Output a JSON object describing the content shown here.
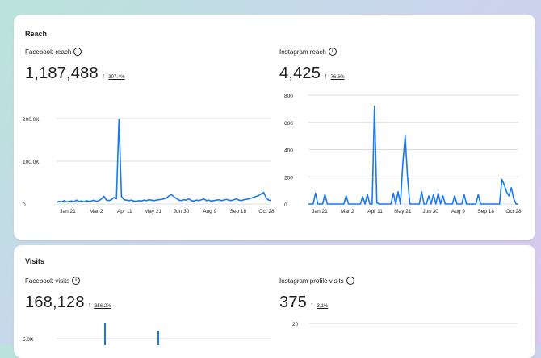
{
  "reach": {
    "title": "Reach",
    "facebook": {
      "label": "Facebook reach",
      "info_icon": "info-icon",
      "value": "1,187,488",
      "trend_arrow": "↑",
      "trend_pct": "307.4%"
    },
    "instagram": {
      "label": "Instagram reach",
      "info_icon": "info-icon",
      "value": "4,425",
      "trend_arrow": "↑",
      "trend_pct": "76.6%"
    }
  },
  "visits": {
    "title": "Visits",
    "facebook": {
      "label": "Facebook visits",
      "info_icon": "info-icon",
      "value": "168,128",
      "trend_arrow": "↑",
      "trend_pct": "356.2%"
    },
    "instagram": {
      "label": "Instagram profile visits",
      "info_icon": "info-icon",
      "value": "375",
      "trend_arrow": "↑",
      "trend_pct": "3.1%"
    }
  },
  "colors": {
    "line": "#1877f2",
    "grid": "#dadde1",
    "text": "#1c1e21"
  },
  "chart_data": [
    {
      "type": "line",
      "name_hint": "facebook-reach",
      "ytick_labels": [
        "0",
        "100.0K",
        "200.0K"
      ],
      "ylim": [
        0,
        200000
      ],
      "xtick_labels": [
        "Jan 21",
        "Mar 2",
        "Apr 11",
        "May 21",
        "Jun 30",
        "Aug 9",
        "Sep 18",
        "Oct 28"
      ],
      "series": [
        {
          "values": [
            4000,
            6000,
            5000,
            8000,
            5000,
            6000,
            7000,
            5000,
            9000,
            6000,
            7000,
            5000,
            8000,
            6000,
            7000,
            9000,
            6000,
            8000,
            12000,
            18000,
            9000,
            8000,
            10000,
            15000,
            12000,
            198000,
            18000,
            10000,
            9000,
            8000,
            9000,
            7000,
            6000,
            8000,
            7000,
            9000,
            8000,
            10000,
            9000,
            8000,
            9000,
            10000,
            11000,
            12000,
            14000,
            19000,
            22000,
            17000,
            13000,
            9000,
            8000,
            10000,
            9000,
            12000,
            8000,
            7000,
            9000,
            8000,
            10000,
            12000,
            8000,
            9000,
            7000,
            8000,
            9000,
            10000,
            8000,
            9000,
            11000,
            9000,
            8000,
            10000,
            12000,
            9000,
            8000,
            10000,
            11000,
            12000,
            14000,
            16000,
            18000,
            20000,
            24000,
            27000,
            14000,
            9000,
            8000
          ]
        }
      ]
    },
    {
      "type": "line",
      "name_hint": "instagram-reach",
      "ytick_labels": [
        "0",
        "200",
        "400",
        "600",
        "800"
      ],
      "ylim": [
        0,
        800
      ],
      "xtick_labels": [
        "Jan 21",
        "Mar 2",
        "Apr 11",
        "May 21",
        "Jun 30",
        "Aug 9",
        "Sep 18",
        "Oct 28"
      ],
      "series": [
        {
          "values": [
            0,
            0,
            0,
            80,
            0,
            0,
            0,
            70,
            0,
            0,
            0,
            0,
            0,
            0,
            0,
            0,
            60,
            0,
            0,
            0,
            0,
            0,
            0,
            55,
            0,
            70,
            0,
            0,
            720,
            10,
            0,
            0,
            0,
            0,
            0,
            0,
            80,
            0,
            90,
            0,
            300,
            500,
            200,
            0,
            0,
            0,
            0,
            0,
            90,
            0,
            0,
            60,
            0,
            70,
            0,
            80,
            0,
            60,
            0,
            0,
            0,
            0,
            60,
            0,
            0,
            0,
            70,
            0,
            0,
            0,
            0,
            0,
            70,
            0,
            0,
            0,
            0,
            0,
            0,
            0,
            0,
            0,
            180,
            140,
            90,
            60,
            120,
            40,
            0,
            0
          ]
        }
      ]
    },
    {
      "type": "line",
      "name_hint": "facebook-visits",
      "ytick_labels": [
        "5.0K"
      ],
      "series": []
    },
    {
      "type": "line",
      "name_hint": "instagram-profile-visits",
      "ytick_labels": [
        "20"
      ],
      "series": []
    }
  ]
}
